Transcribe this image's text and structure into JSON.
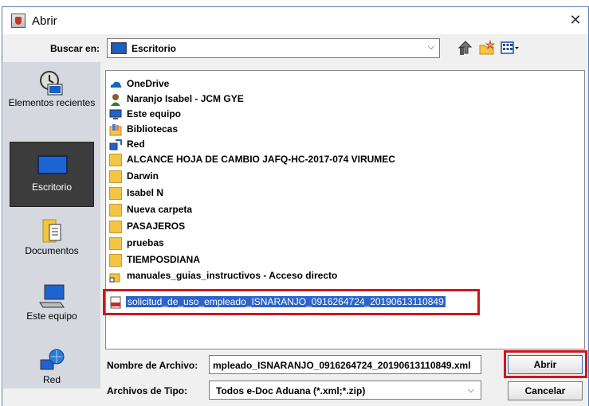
{
  "window": {
    "title": "Abrir",
    "close_glyph": "✕"
  },
  "lookin": {
    "label": "Buscar en:",
    "value": "Escritorio",
    "chevron": "⌵"
  },
  "toolbar": {
    "up_icon": "up-folder-icon",
    "new_icon": "new-folder-icon",
    "view_icon": "view-menu-icon"
  },
  "places": [
    {
      "label": "Elementos recientes",
      "icon": "recent-items-icon"
    },
    {
      "label": "Escritorio",
      "icon": "desktop-icon",
      "selected": true
    },
    {
      "label": "Documentos",
      "icon": "documents-icon"
    },
    {
      "label": "Este equipo",
      "icon": "computer-icon"
    },
    {
      "label": "Red",
      "icon": "network-icon"
    }
  ],
  "files": [
    {
      "name": "OneDrive",
      "icon": "onedrive-icon"
    },
    {
      "name": "Naranjo Isabel - JCM GYE",
      "icon": "user-icon"
    },
    {
      "name": "Este equipo",
      "icon": "computer-icon"
    },
    {
      "name": "Bibliotecas",
      "icon": "libraries-icon"
    },
    {
      "name": "Red",
      "icon": "network-icon"
    },
    {
      "name": "ALCANCE HOJA DE CAMBIO JAFQ-HC-2017-074 VIRUMEC",
      "icon": "folder-icon"
    },
    {
      "name": "Darwin",
      "icon": "folder-icon"
    },
    {
      "name": "Isabel N",
      "icon": "folder-icon"
    },
    {
      "name": "Nueva carpeta",
      "icon": "folder-icon"
    },
    {
      "name": "PASAJEROS",
      "icon": "folder-icon"
    },
    {
      "name": "pruebas",
      "icon": "folder-icon"
    },
    {
      "name": "TIEMPOSDIANA",
      "icon": "folder-icon"
    },
    {
      "name": "manuales_guias_instructivos - Acceso directo",
      "icon": "shortcut-icon"
    },
    {
      "name": "solicitud_de_uso_empleado_ISNARANJO_0916264724_20190613110849",
      "icon": "xml-file-icon",
      "selected": true
    }
  ],
  "filename": {
    "label": "Nombre de Archivo:",
    "value": "mpleado_ISNARANJO_0916264724_20190613110849.xml"
  },
  "filetype": {
    "label": "Archivos de Tipo:",
    "value": "Todos e-Doc Aduana (*.xml;*.zip)",
    "chevron": "⌵"
  },
  "buttons": {
    "open": "Abrir",
    "cancel": "Cancelar"
  },
  "colors": {
    "selection": "#2c64c9",
    "annotation_red": "#d2141c",
    "folder": "#f4c542"
  }
}
